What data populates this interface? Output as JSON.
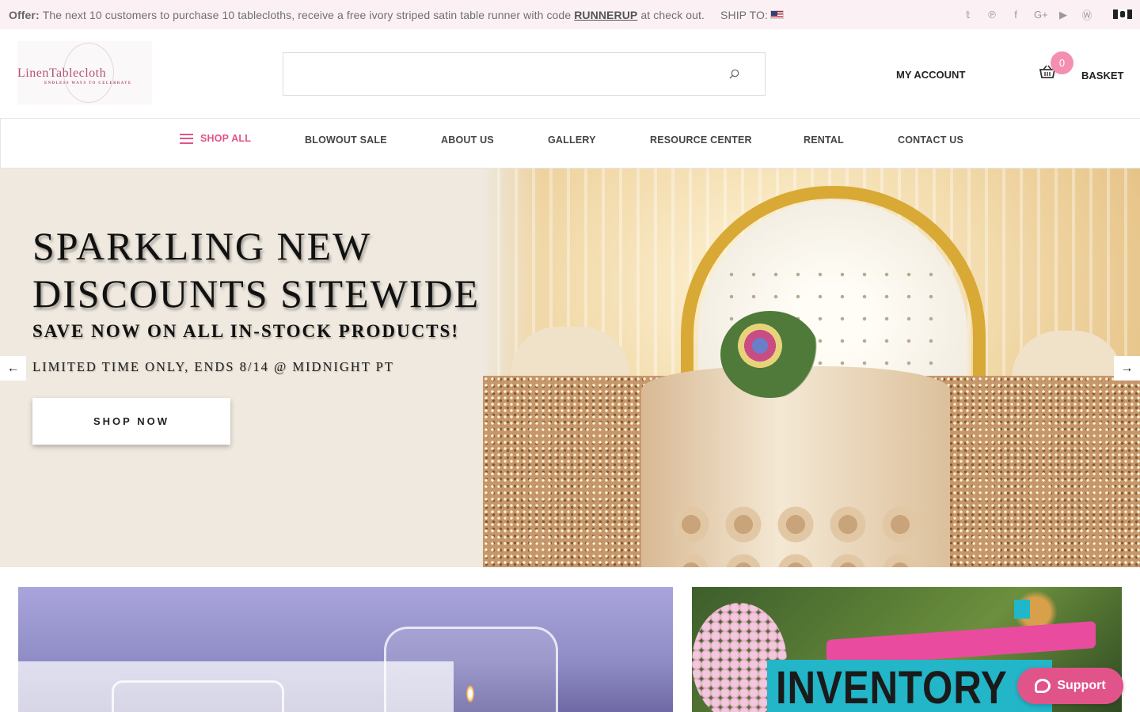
{
  "offer": {
    "label": "Offer:",
    "text_before": "The next 10 customers to purchase 10 tablecloths, receive a free ivory striped satin table runner with code",
    "code": "RUNNERUP",
    "text_after": "at check out.",
    "ship_to": "SHIP TO:"
  },
  "socials": {
    "icons": [
      "twitter-icon",
      "pinterest-icon",
      "facebook-icon",
      "google-plus-icon",
      "youtube-icon",
      "wordpress-icon"
    ],
    "twitter": "𝕥",
    "pinterest": "℗",
    "facebook": "f",
    "google_plus": "G+",
    "youtube": "▶",
    "wordpress": "Ⓦ"
  },
  "logo": {
    "name": "LinenTablecloth",
    "tagline": "ENDLESS WAYS TO CELEBRATE"
  },
  "header": {
    "search_placeholder": "",
    "account_label": "MY ACCOUNT",
    "basket_count": "0",
    "basket_label": "BASKET"
  },
  "nav": {
    "shop_all": "SHOP ALL",
    "blowout_sale": "BLOWOUT SALE",
    "about_us": "ABOUT US",
    "gallery": "GALLERY",
    "resource_center": "RESOURCE CENTER",
    "rental": "RENTAL",
    "contact_us": "CONTACT US"
  },
  "hero": {
    "title_line1": "SPARKLING NEW",
    "title_line2": "DISCOUNTS SITEWIDE",
    "subtitle": "SAVE NOW ON ALL IN-STOCK PRODUCTS!",
    "limited": "LIMITED TIME ONLY, ENDS 8/14 @ MIDNIGHT PT",
    "cta": "SHOP NOW",
    "prev_arrow": "←",
    "next_arrow": "→"
  },
  "promo_right": {
    "text": "INVENTORY"
  },
  "support": {
    "label": "Support"
  },
  "colors": {
    "accent_pink": "#e0548a",
    "offer_bg": "#fbf1f4",
    "hero_bg": "#efe9df",
    "badge_pink": "#f48fb1"
  }
}
